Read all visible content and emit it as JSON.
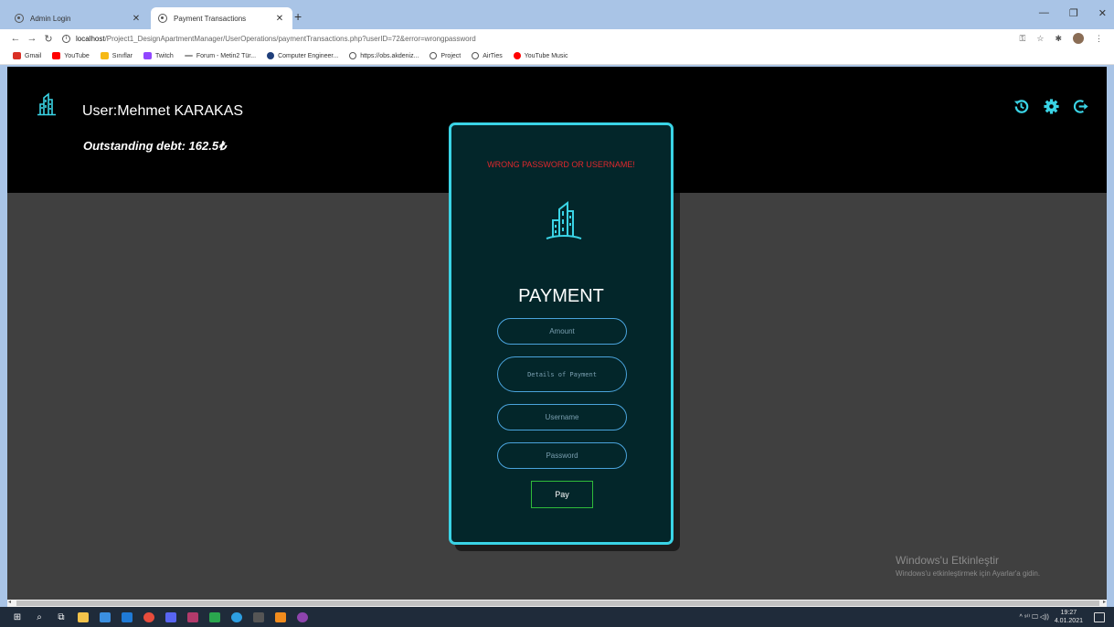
{
  "browser": {
    "tabs": [
      {
        "title": "Admin Login",
        "active": false
      },
      {
        "title": "Payment Transactions",
        "active": true
      }
    ],
    "new_tab": "+",
    "url_host": "localhost",
    "url_path": "/Project1_DesignApartmentManager/UserOperations/paymentTransactions.php?userID=72&error=wrongpassword",
    "bookmarks": [
      {
        "label": "Gmail",
        "icon": "gmail-icon",
        "color": "#d93025"
      },
      {
        "label": "YouTube",
        "icon": "youtube-icon",
        "color": "#ff0000"
      },
      {
        "label": "Sınıflar",
        "icon": "classroom-icon",
        "color": "#f6b915"
      },
      {
        "label": "Twitch",
        "icon": "twitch-icon",
        "color": "#9146ff"
      },
      {
        "label": "Forum - Metin2 Tür...",
        "icon": "forum-icon",
        "color": "#777777"
      },
      {
        "label": "Computer Engineer...",
        "icon": "globe-icon",
        "color": "#1f3e7a"
      },
      {
        "label": "https://obs.akdeniz...",
        "icon": "globe-icon",
        "color": "#555555"
      },
      {
        "label": "Project",
        "icon": "globe-icon",
        "color": "#555555"
      },
      {
        "label": "AirTies",
        "icon": "globe-icon",
        "color": "#555555"
      },
      {
        "label": "YouTube Music",
        "icon": "youtube-music-icon",
        "color": "#ff0000"
      }
    ]
  },
  "header": {
    "user_label": "User:Mehmet KARAKAS",
    "debt_label": "Outstanding debt: 162.5₺",
    "icons": [
      "history-icon",
      "settings-gear-icon",
      "logout-icon"
    ],
    "accent_color": "#3ad4e6"
  },
  "payment_card": {
    "error": "WRONG PASSWORD OR USERNAME!",
    "title": "PAYMENT",
    "amount_placeholder": "Amount",
    "details_placeholder": "Details of Payment",
    "username_placeholder": "Username",
    "password_placeholder": "Password",
    "pay_label": "Pay",
    "error_color": "#e0282d",
    "button_border_color": "#2fbb3a"
  },
  "watermark": {
    "title": "Windows'u Etkinleştir",
    "subtitle": "Windows'u etkinleştirmek için Ayarlar'a gidin."
  },
  "taskbar": {
    "time": "19:27",
    "date": "4.01.2021",
    "tray_lang": "^ ⁹⁽⁾ 🖵 ◁))"
  }
}
